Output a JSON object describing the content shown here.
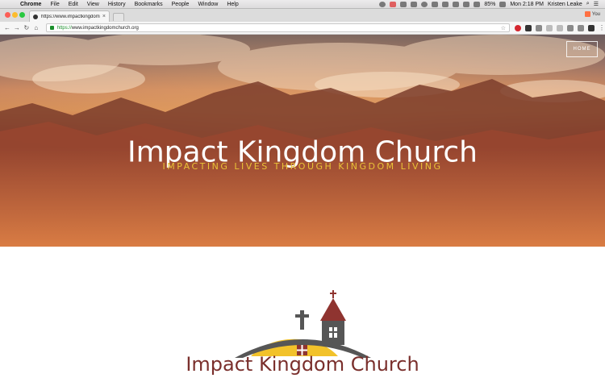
{
  "menubar": {
    "app": "Chrome",
    "items": [
      "File",
      "Edit",
      "View",
      "History",
      "Bookmarks",
      "People",
      "Window",
      "Help"
    ],
    "battery": "85%",
    "clock": "Mon 2:18 PM",
    "user": "Kristen Leake"
  },
  "browser": {
    "tab_title": "https://www.impactkingdomc",
    "profile_label": "You",
    "url_scheme": "https://",
    "url_rest": "www.impactkingdomchurch.org"
  },
  "site": {
    "nav_home": "HOME",
    "hero_title": "Impact Kingdom Church",
    "hero_subtitle": "IMPACTING LIVES THROUGH KINGDOM LIVING",
    "logo_text": "Impact Kingdom Church"
  },
  "colors": {
    "subtitle_gold": "#e9c237",
    "logo_sun": "#f2c22a",
    "logo_roof": "#565656",
    "logo_text": "#7a2f2c",
    "steeple_red": "#8f3430"
  }
}
